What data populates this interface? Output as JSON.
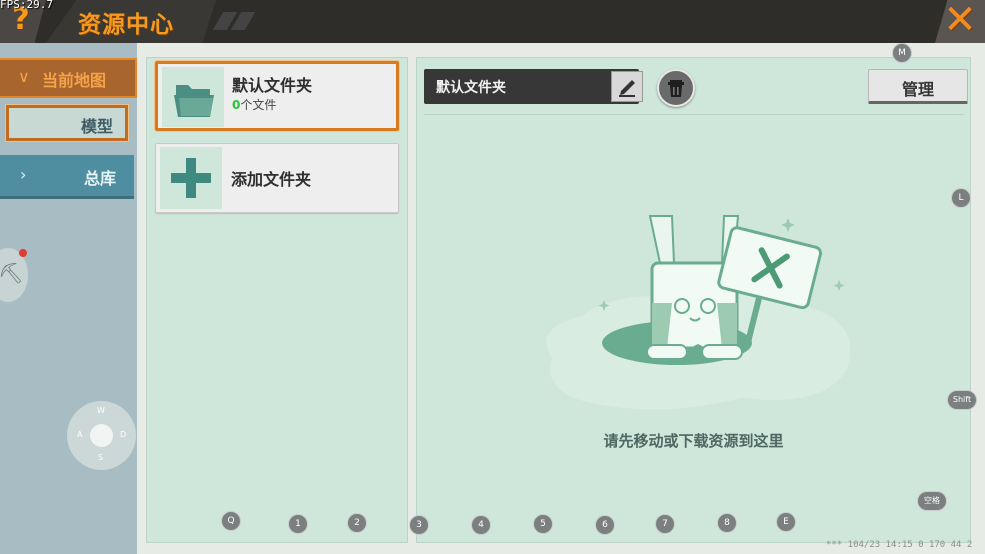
{
  "header": {
    "fps": "FPS:29.7",
    "help_icon": "question-mark-icon",
    "title": "资源中心",
    "close_icon": "close-x-icon",
    "close_sub": "~"
  },
  "sidebar": {
    "current_map": {
      "chevron": "∨",
      "label": "当前地图"
    },
    "model": {
      "label": "模型"
    },
    "library": {
      "chevron": "›",
      "label": "总库"
    },
    "gadget_icon": "map-toggle-icon",
    "joystick": {
      "w": "W",
      "a": "A",
      "s": "S",
      "d": "D"
    }
  },
  "folders": {
    "default": {
      "name": "默认文件夹",
      "count": "0",
      "count_suffix": "个文件",
      "icon": "open-folder-icon"
    },
    "add": {
      "name": "添加文件夹",
      "icon": "plus-icon"
    }
  },
  "detail": {
    "folder_name": "默认文件夹",
    "edit_icon": "pencil-icon",
    "delete_icon": "trash-icon",
    "manage_label": "管理",
    "empty_hint": "请先移动或下载资源到这里"
  },
  "keys": {
    "m": "M",
    "l": "L",
    "shift": "Shift",
    "space": "空格",
    "q": "Q",
    "k1": "1",
    "k2": "2",
    "k3": "3",
    "k4": "4",
    "k5": "5",
    "k6": "6",
    "k7": "7",
    "k8": "8",
    "e": "E"
  },
  "status": "*** 104/23 14:15 0 170 44 2",
  "colors": {
    "accent_orange": "#f59a1f",
    "panel_green": "#cfe6da",
    "sidebar_blue": "#a7bdc3",
    "library_tab": "#4f8ea0",
    "count_green": "#29c33a"
  }
}
